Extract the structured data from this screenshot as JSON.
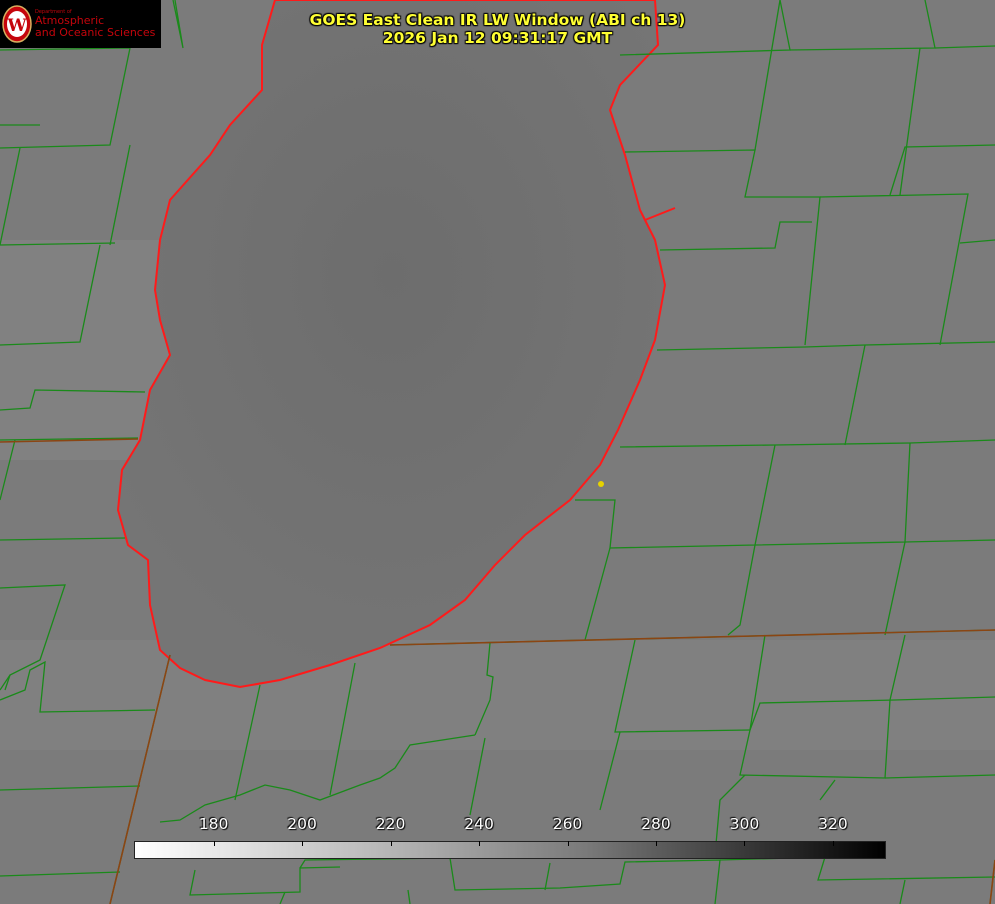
{
  "logo": {
    "department": "Department of",
    "line1": "Atmospheric",
    "line2": "and Oceanic Sciences",
    "seal_letter": "W"
  },
  "title": {
    "line1": "GOES East Clean IR LW Window (ABI ch 13)",
    "line2": "2026 Jan 12 09:31:17 GMT"
  },
  "colorbar": {
    "ticks": [
      "180",
      "200",
      "220",
      "240",
      "260",
      "280",
      "300",
      "320"
    ],
    "range": [
      162,
      332
    ]
  },
  "colors": {
    "background": "#7a7a7a",
    "county_lines": "#1a8a1a",
    "coastline": "#ff1a1a",
    "title_text": "#ffff33",
    "brand": "#c5050c",
    "station_marker": "#e6d200"
  }
}
